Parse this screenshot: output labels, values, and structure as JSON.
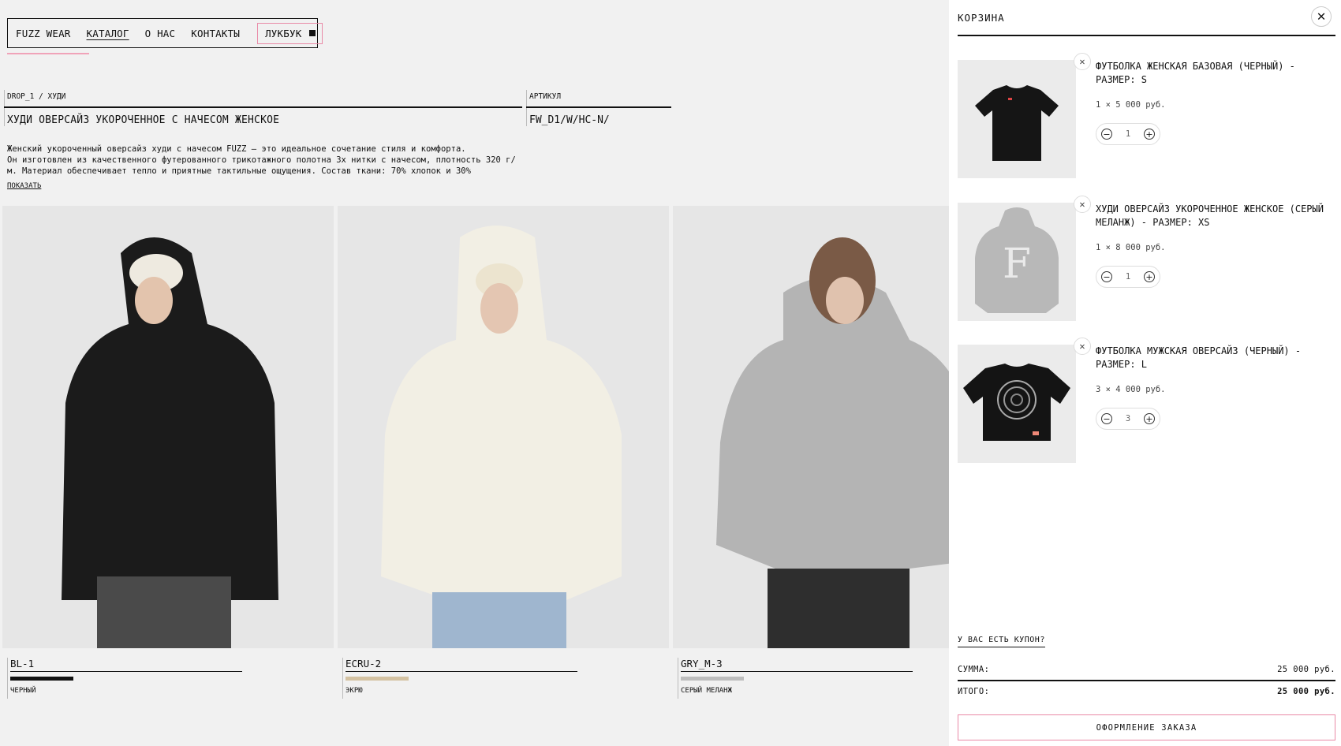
{
  "nav": {
    "brand": "FUZZ WEAR",
    "catalog": "КАТАЛОГ",
    "about": "О НАС",
    "contacts": "КОНТАКТЫ",
    "lookbook": "ЛУКБУК"
  },
  "product": {
    "breadcrumb": "DROP_1 / ХУДИ",
    "title": "ХУДИ ОВЕРСАЙЗ УКОРОЧЕННОЕ С НАЧЕСОМ ЖЕНСКОЕ",
    "article_label": "АРТИКУЛ",
    "article_value": "FW_D1/W/HC-N/",
    "description_lines": [
      "Женский укороченный оверсайз худи с начесом FUZZ — это идеальное сочетание стиля и комфорта.",
      "Он изготовлен из качественного футерованного трикотажного полотна 3х нитки с начесом, плотность 320 г/",
      "м. Материал обеспечивает тепло и приятные тактильные ощущения. Состав ткани: 70% хлопок и 30%"
    ],
    "show_more": "ПОКАЗАТЬ"
  },
  "variants": [
    {
      "code": "BL-1",
      "color_name": "ЧЕРНЫЙ",
      "swatch": "#111111",
      "garment": "#1b1b1b"
    },
    {
      "code": "ECRU-2",
      "color_name": "ЭКРЮ",
      "swatch": "#d4c2a2",
      "garment": "#f2efe4"
    },
    {
      "code": "GRY_M-3",
      "color_name": "СЕРЫЙ МЕЛАНЖ",
      "swatch": "#bdbdbd",
      "garment": "#b4b4b4"
    }
  ],
  "cart": {
    "title": "КОРЗИНА",
    "items": [
      {
        "name": "ФУТБОЛКА ЖЕНСКАЯ БАЗОВАЯ (ЧЕРНЫЙ) - РАЗМЕР: S",
        "price": "1 × 5 000 руб.",
        "qty": "1"
      },
      {
        "name": "ХУДИ ОВЕРСАЙЗ УКОРОЧЕННОЕ ЖЕНСКОЕ (СЕРЫЙ МЕЛАНЖ) - РАЗМЕР: XS",
        "price": "1 × 8 000 руб.",
        "qty": "1"
      },
      {
        "name": "ФУТБОЛКА МУЖСКАЯ ОВЕРСАЙЗ (ЧЕРНЫЙ) - РАЗМЕР: L",
        "price": "3 × 4 000 руб.",
        "qty": "3"
      }
    ],
    "coupon": "У ВАС ЕСТЬ КУПОН?",
    "sum_label": "СУММА:",
    "sum_value": "25 000 руб.",
    "total_label": "ИТОГО:",
    "total_value": "25 000 руб.",
    "checkout": "ОФОРМЛЕНИЕ ЗАКАЗА"
  },
  "colors": {
    "accent_pink": "#e98aa7",
    "text": "#111111",
    "background": "#f1f1f1"
  }
}
